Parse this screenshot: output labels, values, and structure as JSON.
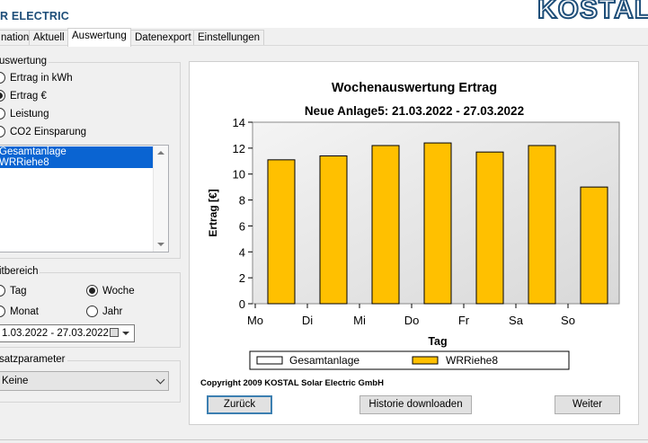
{
  "app": {
    "brand": "R ELECTRIC",
    "logo": "KOSTAL"
  },
  "tabs": [
    {
      "label": "nation"
    },
    {
      "label": "Aktuell"
    },
    {
      "label": "Auswertung",
      "active": true
    },
    {
      "label": "Datenexport"
    },
    {
      "label": "Einstellungen"
    }
  ],
  "auswertung": {
    "legend": "uswertung",
    "options": [
      {
        "label": "Ertrag in kWh",
        "checked": false
      },
      {
        "label": "Ertrag €",
        "checked": true
      },
      {
        "label": "Leistung",
        "checked": false
      },
      {
        "label": "CO2 Einsparung",
        "checked": false
      }
    ]
  },
  "anlagen_list": {
    "items": [
      "Gesamtanlage",
      "WRRiehe8"
    ]
  },
  "zeitbereich": {
    "legend": "itbereich",
    "options": [
      {
        "label": "Tag",
        "checked": false
      },
      {
        "label": "Woche",
        "checked": true
      },
      {
        "label": "Monat",
        "checked": false
      },
      {
        "label": "Jahr",
        "checked": false
      }
    ],
    "date_range": "1.03.2022 - 27.03.2022"
  },
  "zusatzparameter": {
    "legend": "satzparameter",
    "selected": "Keine"
  },
  "copyright": "Copyright 2009 KOSTAL Solar Electric GmbH",
  "buttons": {
    "back": "Zurück",
    "download": "Historie downloaden",
    "next": "Weiter"
  },
  "colors": {
    "bar": "#ffc000",
    "brand": "#1e4e79",
    "selection": "#0a64d2"
  },
  "chart_data": {
    "type": "bar",
    "title": "Wochenauswertung Ertrag",
    "subtitle": "Neue Anlage5: 21.03.2022 - 27.03.2022",
    "xlabel": "Tag",
    "ylabel": "Ertrag [€]",
    "ylim": [
      0,
      14
    ],
    "yticks": [
      0,
      2,
      4,
      6,
      8,
      10,
      12,
      14
    ],
    "xtick_labels": [
      "Mo",
      "Di",
      "Mi",
      "Do",
      "Fr",
      "Sa",
      "So"
    ],
    "legend_placement": "bottom",
    "grid": false,
    "series": [
      {
        "name": "Gesamtanlage",
        "values": [],
        "color": "#ffffff"
      },
      {
        "name": "WRRiehe8",
        "values": [
          11.1,
          11.4,
          12.2,
          12.4,
          11.7,
          12.2,
          9.0
        ],
        "color": "#ffc000"
      }
    ]
  }
}
